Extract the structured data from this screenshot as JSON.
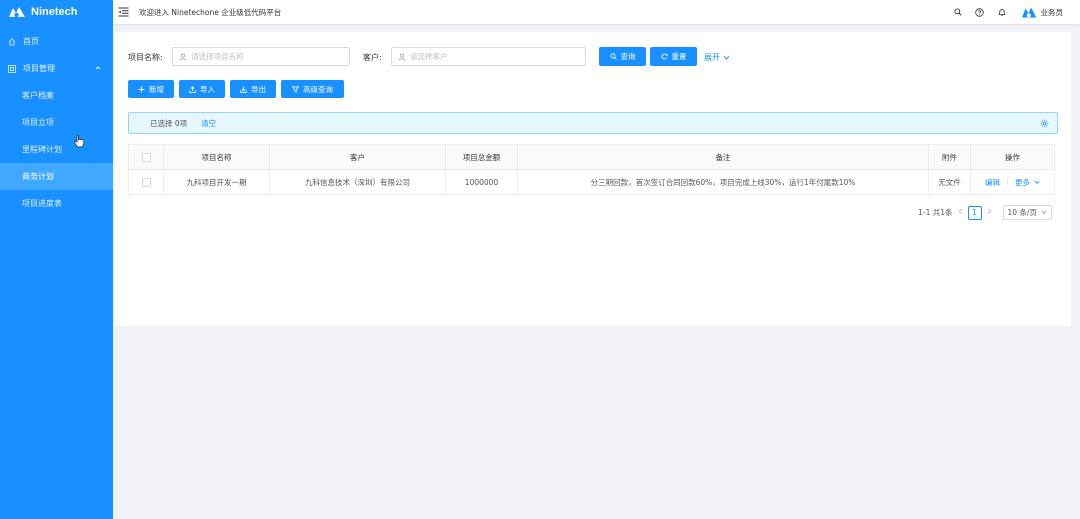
{
  "app": {
    "brand": "Ninetech"
  },
  "sidebar": {
    "items": [
      {
        "label": "首页",
        "icon": "home-icon"
      },
      {
        "label": "项目管理",
        "icon": "appstore-icon",
        "expanded": true
      },
      {
        "label": "客户档案"
      },
      {
        "label": "项目立项"
      },
      {
        "label": "里程碑计划"
      },
      {
        "label": "商务计划",
        "active": true
      },
      {
        "label": "项目进度表"
      }
    ]
  },
  "header": {
    "welcome": "欢迎进入 Ninetechone 企业级低代码平台",
    "user_name": "业务员"
  },
  "search": {
    "project_label": "项目名称:",
    "project_placeholder": "请选择项目名称",
    "customer_label": "客户:",
    "customer_placeholder": "请选择客户",
    "query_label": "查询",
    "reset_label": "重置",
    "expand_label": "展开"
  },
  "toolbar": {
    "add_label": "新增",
    "import_label": "导入",
    "export_label": "导出",
    "advanced_label": "高级查询"
  },
  "selection": {
    "text": "已选择 0项",
    "clear_label": "清空"
  },
  "table": {
    "columns": [
      "项目名称",
      "客户",
      "项目总金额",
      "备注",
      "附件",
      "操作"
    ],
    "rows": [
      {
        "project": "九科项目开发一期",
        "customer": "九科信息技术（深圳）有限公司",
        "amount": "1000000",
        "remark": "分三期回款，首次签订合同回款60%，项目完成上线30%，运行1年付尾款10%",
        "attachment": "无文件",
        "edit": "编辑",
        "more": "更多"
      }
    ]
  },
  "pagination": {
    "summary": "1-1 共1条",
    "current": "1",
    "page_size": "10 条/页"
  },
  "colors": {
    "primary": "#1890ff",
    "active_menu": "#40a9ff",
    "alert_bg": "#e6f7ff"
  }
}
